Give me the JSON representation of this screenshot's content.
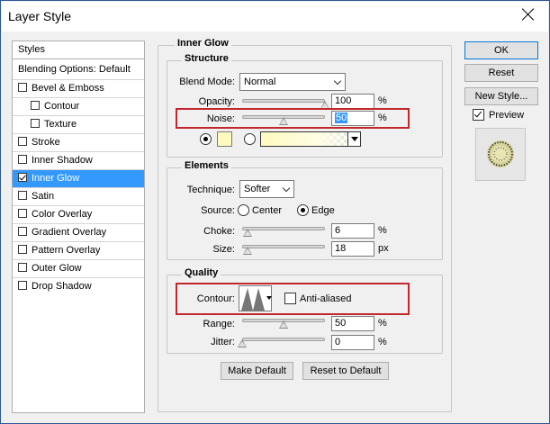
{
  "window": {
    "title": "Layer Style"
  },
  "sidebar": {
    "header": "Styles",
    "blending": "Blending Options: Default",
    "items": [
      {
        "label": "Bevel & Emboss",
        "checked": false
      },
      {
        "label": "Contour",
        "checked": false
      },
      {
        "label": "Texture",
        "checked": false
      },
      {
        "label": "Stroke",
        "checked": false
      },
      {
        "label": "Inner Shadow",
        "checked": false
      },
      {
        "label": "Inner Glow",
        "checked": true
      },
      {
        "label": "Satin",
        "checked": false
      },
      {
        "label": "Color Overlay",
        "checked": false
      },
      {
        "label": "Gradient Overlay",
        "checked": false
      },
      {
        "label": "Pattern Overlay",
        "checked": false
      },
      {
        "label": "Outer Glow",
        "checked": false
      },
      {
        "label": "Drop Shadow",
        "checked": false
      }
    ]
  },
  "panel": {
    "title": "Inner Glow",
    "structure": {
      "title": "Structure",
      "blend_mode_label": "Blend Mode:",
      "blend_mode_value": "Normal",
      "opacity_label": "Opacity:",
      "opacity_value": "100",
      "opacity_level": 1.0,
      "noise_label": "Noise:",
      "noise_value": "50",
      "noise_level": 0.5,
      "pct": "%",
      "swatch_color": "#fffbbf"
    },
    "elements": {
      "title": "Elements",
      "technique_label": "Technique:",
      "technique_value": "Softer",
      "source_label": "Source:",
      "source_center": "Center",
      "source_edge": "Edge",
      "choke_label": "Choke:",
      "choke_value": "6",
      "choke_level": 0.06,
      "size_label": "Size:",
      "size_value": "18",
      "size_unit": "px",
      "size_level": 0.07,
      "pct": "%"
    },
    "quality": {
      "title": "Quality",
      "contour_label": "Contour:",
      "anti_aliased_label": "Anti-aliased",
      "range_label": "Range:",
      "range_value": "50",
      "range_level": 0.5,
      "jitter_label": "Jitter:",
      "jitter_value": "0",
      "jitter_level": 0.0,
      "pct": "%"
    },
    "make_default": "Make Default",
    "reset_to_default": "Reset to Default"
  },
  "buttons": {
    "ok": "OK",
    "reset": "Reset",
    "new_style": "New Style...",
    "preview_label": "Preview"
  },
  "colors": {
    "selection": "#3399ff",
    "highlight_box": "#c1272d"
  }
}
